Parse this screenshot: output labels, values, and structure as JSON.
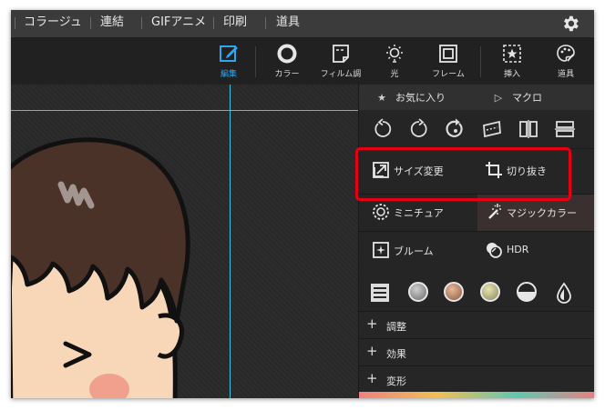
{
  "menu": {
    "items": [
      "コラージュ",
      "連結",
      "GIFアニメ",
      "印刷",
      "道具"
    ]
  },
  "toolbar": {
    "tools": [
      {
        "label": "編集",
        "icon": "edit-icon",
        "active": true
      },
      {
        "label": "カラー",
        "icon": "color-circle-icon"
      },
      {
        "label": "フィルム調",
        "icon": "film-icon"
      },
      {
        "label": "光",
        "icon": "light-bulb-icon"
      },
      {
        "label": "フレーム",
        "icon": "frame-icon"
      },
      {
        "label": "挿入",
        "icon": "insert-star-icon"
      },
      {
        "label": "道具",
        "icon": "palette-icon"
      }
    ]
  },
  "panel": {
    "tabs": {
      "favorites": "お気に入り",
      "macro": "マクロ"
    },
    "rotate_icons": [
      "rotate-left-icon",
      "rotate-right-icon",
      "rotate-free-icon",
      "skew-icon",
      "flip-horizontal-icon",
      "flip-vertical-icon"
    ],
    "features": {
      "resize": "サイズ変更",
      "crop": "切り抜き",
      "miniature": "ミニチュア",
      "magic_color": "マジックカラー",
      "bloom": "ブルーム",
      "hdr": "HDR"
    },
    "accordion": {
      "adjust": "調整",
      "effects": "効果",
      "transform": "変形"
    },
    "accordion_symbol": "+"
  },
  "colors": {
    "accent": "#2ea6f0",
    "guide": "#3ac6e2",
    "highlight": "#e60012"
  }
}
